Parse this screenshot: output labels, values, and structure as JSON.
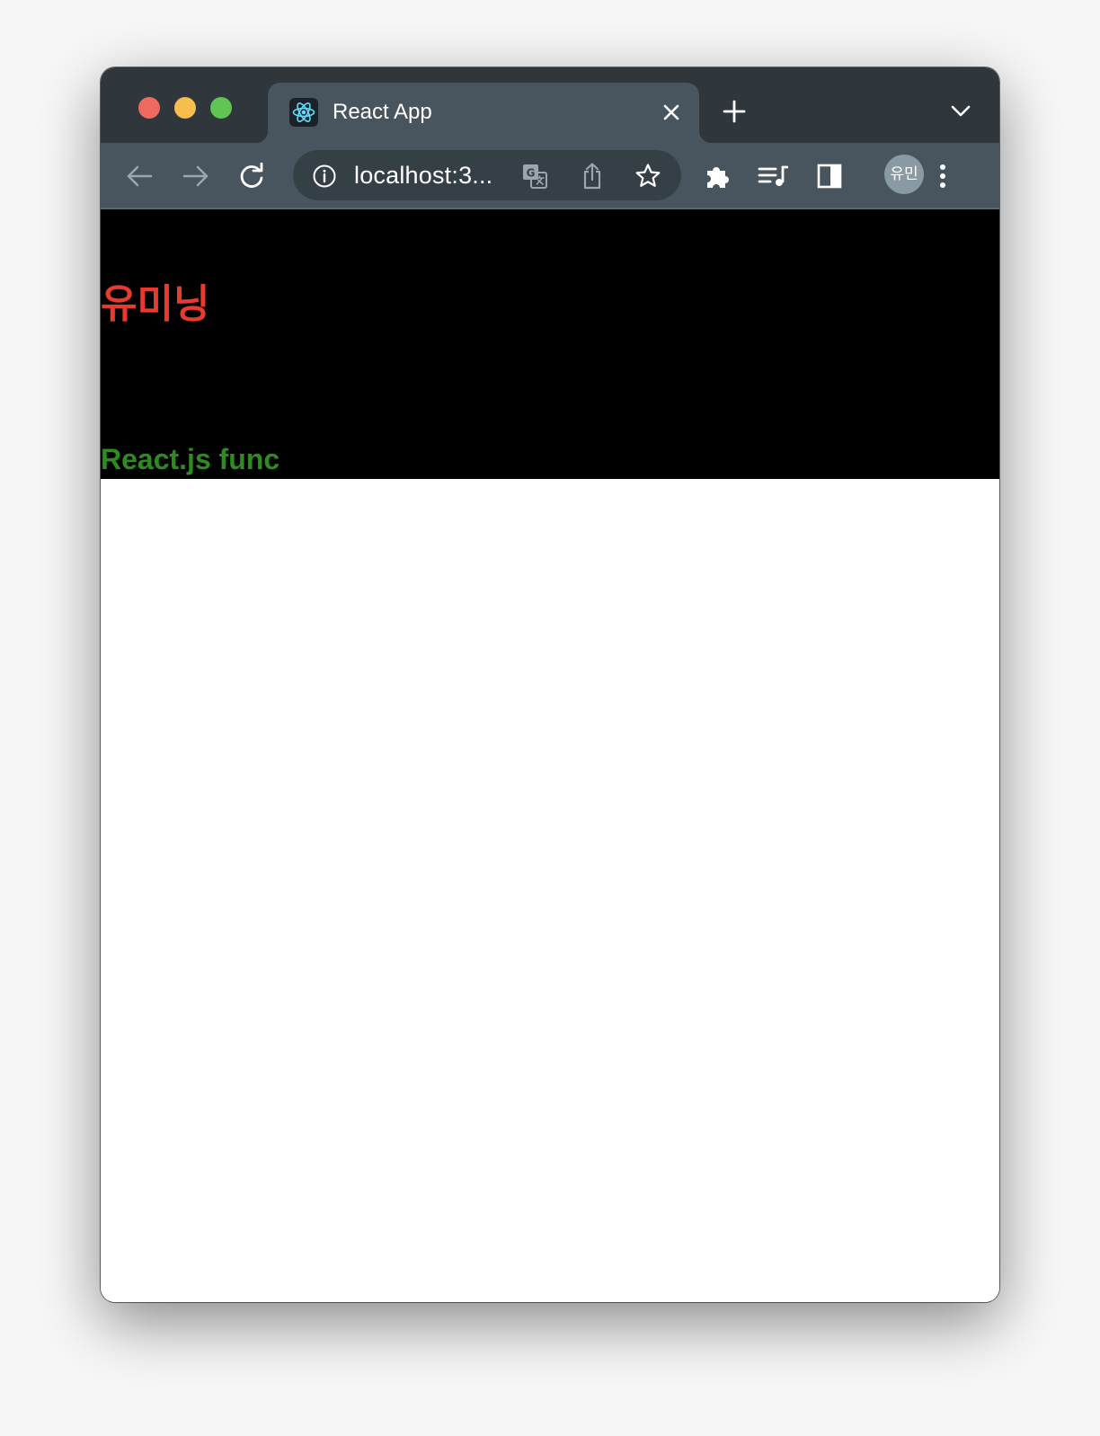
{
  "browser": {
    "tab": {
      "title": "React App",
      "favicon": "react-logo-icon"
    },
    "address_bar": {
      "url_display": "localhost:3..."
    },
    "profile": {
      "avatar_label": "유민"
    },
    "colors": {
      "titlebar": "#2f373d",
      "toolbar": "#48555e",
      "omnibox": "#353f46",
      "traffic_red": "#ee6a5f",
      "traffic_yellow": "#f5be4f",
      "traffic_green": "#61c554"
    }
  },
  "page": {
    "header": {
      "title": "유미닝",
      "subtitle": "React.js func",
      "background": "#000000",
      "title_color": "#e63b2e",
      "subtitle_color": "#2f8a21"
    }
  }
}
